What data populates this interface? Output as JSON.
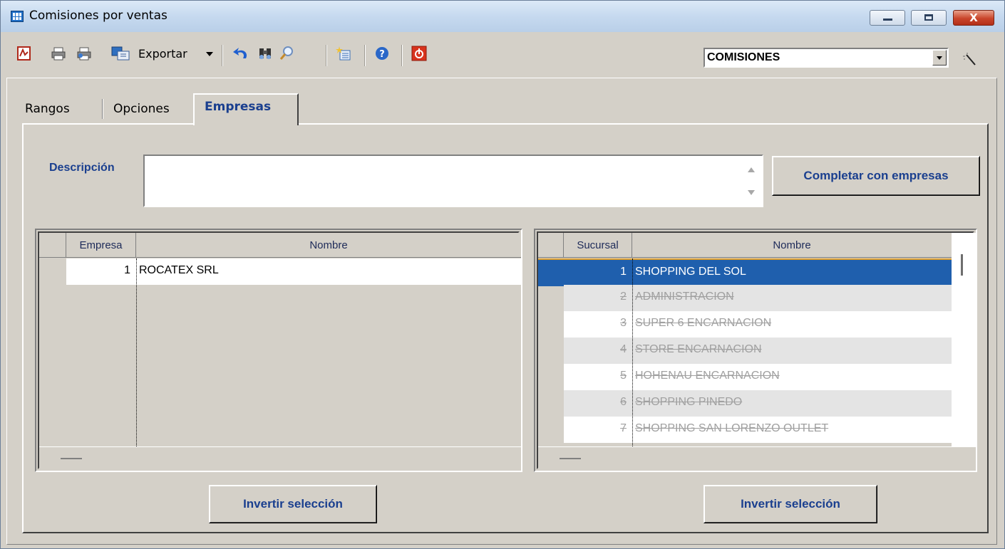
{
  "window": {
    "title": "Comisiones por ventas"
  },
  "toolbar": {
    "export_label": "Exportar",
    "combo_value": "COMISIONES",
    "icons": [
      "pdf-icon",
      "print-icon",
      "print-preview-icon",
      "export-icon",
      "undo-icon",
      "find-icon",
      "zoom-icon",
      "new-icon",
      "help-icon",
      "exit-icon",
      "wand-icon"
    ]
  },
  "tabs": [
    {
      "label": "Rangos",
      "active": false
    },
    {
      "label": "Opciones",
      "active": false
    },
    {
      "label": "Empresas",
      "active": true
    }
  ],
  "form": {
    "description_label": "Descripción",
    "description_value": "",
    "complete_button": "Completar con empresas"
  },
  "empresas_grid": {
    "columns": [
      "Empresa",
      "Nombre"
    ],
    "rows": [
      {
        "id": "1",
        "name": "ROCATEX SRL"
      }
    ],
    "invert_button": "Invertir selección"
  },
  "sucursales_grid": {
    "columns": [
      "Sucursal",
      "Nombre"
    ],
    "rows": [
      {
        "id": "1",
        "name": "SHOPPING DEL SOL",
        "selected": true
      },
      {
        "id": "2",
        "name": "ADMINISTRACION",
        "selected": false
      },
      {
        "id": "3",
        "name": "SUPER 6 ENCARNACION",
        "selected": false
      },
      {
        "id": "4",
        "name": "STORE ENCARNACION",
        "selected": false
      },
      {
        "id": "5",
        "name": "HOHENAU ENCARNACION",
        "selected": false
      },
      {
        "id": "6",
        "name": "SHOPPING PINEDO",
        "selected": false
      },
      {
        "id": "7",
        "name": "SHOPPING SAN LORENZO OUTLET",
        "selected": false
      }
    ],
    "invert_button": "Invertir selección"
  },
  "colors": {
    "label_blue": "#1a3f8f",
    "selection": "#1f5fad",
    "selection_border": "#e0a030"
  }
}
